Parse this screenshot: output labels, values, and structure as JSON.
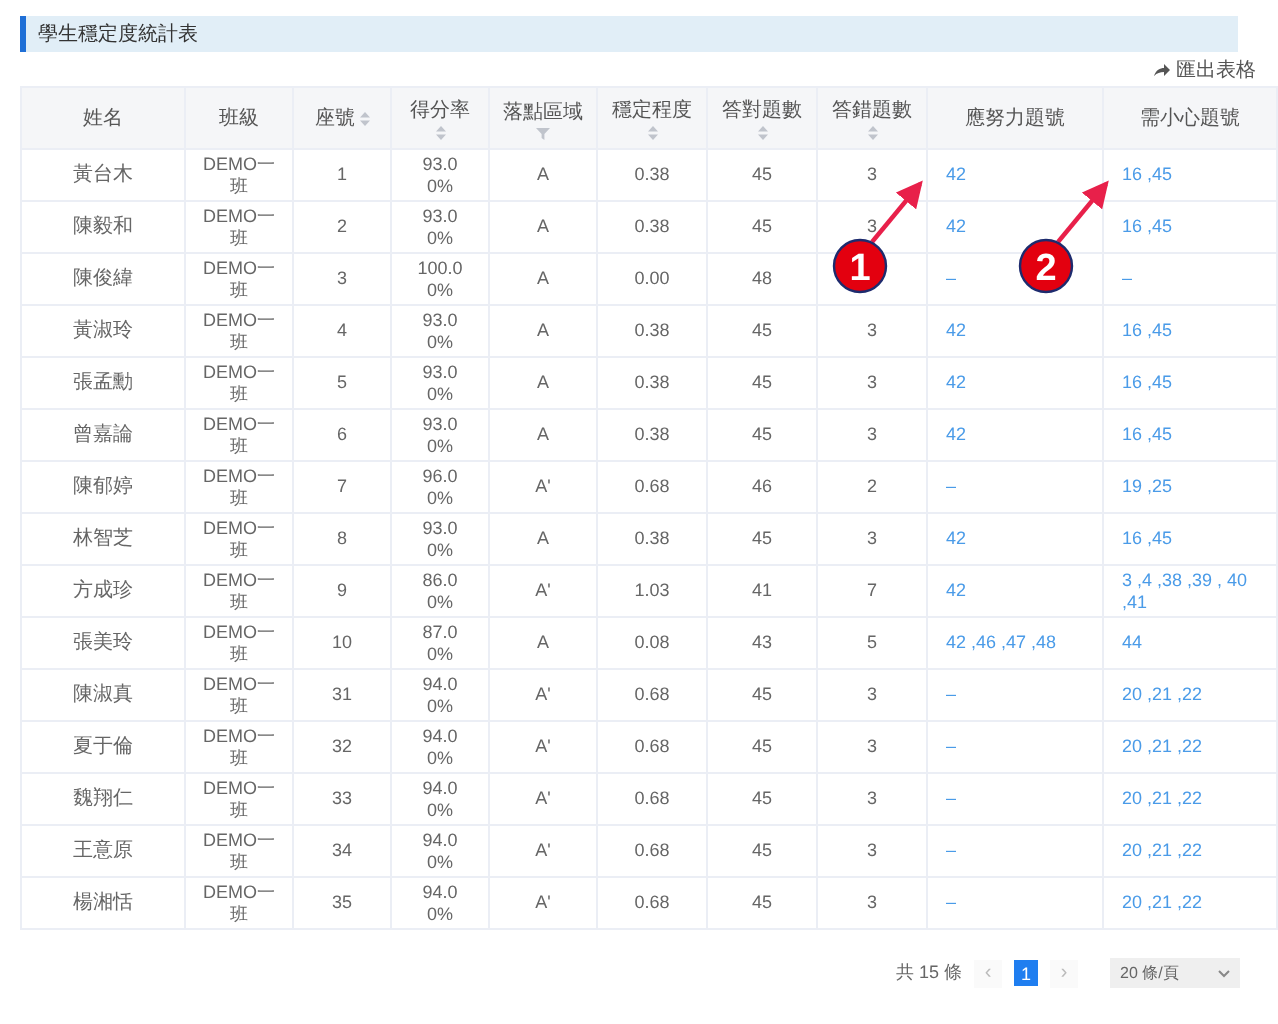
{
  "title": "學生穩定度統計表",
  "export_link": "匯出表格",
  "table": {
    "columns": [
      {
        "label": "姓名",
        "sort": false,
        "filter": false
      },
      {
        "label": "班級",
        "sort": false,
        "filter": false
      },
      {
        "label": "座號",
        "sort": true,
        "filter": false
      },
      {
        "label": "得分率",
        "sort": true,
        "filter": false
      },
      {
        "label": "落點區域",
        "sort": false,
        "filter": true
      },
      {
        "label": "穩定程度",
        "sort": true,
        "filter": false
      },
      {
        "label": "答對題數",
        "sort": true,
        "filter": false
      },
      {
        "label": "答錯題數",
        "sort": true,
        "filter": false
      },
      {
        "label": "應努力題號",
        "sort": false,
        "filter": false
      },
      {
        "label": "需小心題號",
        "sort": false,
        "filter": false
      }
    ],
    "rows": [
      {
        "name": "黃台木",
        "class": "DEMO一班",
        "seat": "1",
        "score": "93.00%",
        "zone": "A",
        "stability": "0.38",
        "correct": "45",
        "wrong": "3",
        "effort": "42",
        "careful": "16 ,45"
      },
      {
        "name": "陳毅和",
        "class": "DEMO一班",
        "seat": "2",
        "score": "93.00%",
        "zone": "A",
        "stability": "0.38",
        "correct": "45",
        "wrong": "3",
        "effort": "42",
        "careful": "16 ,45"
      },
      {
        "name": "陳俊緯",
        "class": "DEMO一班",
        "seat": "3",
        "score": "100.00%",
        "zone": "A",
        "stability": "0.00",
        "correct": "48",
        "effort": "–",
        "careful": "–"
      },
      {
        "name": "黃淑玲",
        "class": "DEMO一班",
        "seat": "4",
        "score": "93.00%",
        "zone": "A",
        "stability": "0.38",
        "correct": "45",
        "wrong": "3",
        "effort": "42",
        "careful": "16 ,45"
      },
      {
        "name": "張孟勳",
        "class": "DEMO一班",
        "seat": "5",
        "score": "93.00%",
        "zone": "A",
        "stability": "0.38",
        "correct": "45",
        "wrong": "3",
        "effort": "42",
        "careful": "16 ,45"
      },
      {
        "name": "曾嘉論",
        "class": "DEMO一班",
        "seat": "6",
        "score": "93.00%",
        "zone": "A",
        "stability": "0.38",
        "correct": "45",
        "wrong": "3",
        "effort": "42",
        "careful": "16 ,45"
      },
      {
        "name": "陳郁婷",
        "class": "DEMO一班",
        "seat": "7",
        "score": "96.00%",
        "zone": "A'",
        "stability": "0.68",
        "correct": "46",
        "wrong": "2",
        "effort": "–",
        "careful": "19 ,25"
      },
      {
        "name": "林智芝",
        "class": "DEMO一班",
        "seat": "8",
        "score": "93.00%",
        "zone": "A",
        "stability": "0.38",
        "correct": "45",
        "wrong": "3",
        "effort": "42",
        "careful": "16 ,45"
      },
      {
        "name": "方成珍",
        "class": "DEMO一班",
        "seat": "9",
        "score": "86.00%",
        "zone": "A'",
        "stability": "1.03",
        "correct": "41",
        "wrong": "7",
        "effort": "42",
        "careful": "3 ,4 ,38 ,39 , 40 ,41"
      },
      {
        "name": "張美玲",
        "class": "DEMO一班",
        "seat": "10",
        "score": "87.00%",
        "zone": "A",
        "stability": "0.08",
        "correct": "43",
        "wrong": "5",
        "effort": "42 ,46 ,47 ,48",
        "careful": "44"
      },
      {
        "name": "陳淑真",
        "class": "DEMO一班",
        "seat": "31",
        "score": "94.00%",
        "zone": "A'",
        "stability": "0.68",
        "correct": "45",
        "wrong": "3",
        "effort": "–",
        "careful": "20 ,21 ,22"
      },
      {
        "name": "夏于倫",
        "class": "DEMO一班",
        "seat": "32",
        "score": "94.00%",
        "zone": "A'",
        "stability": "0.68",
        "correct": "45",
        "wrong": "3",
        "effort": "–",
        "careful": "20 ,21 ,22"
      },
      {
        "name": "魏翔仁",
        "class": "DEMO一班",
        "seat": "33",
        "score": "94.00%",
        "zone": "A'",
        "stability": "0.68",
        "correct": "45",
        "wrong": "3",
        "effort": "–",
        "careful": "20 ,21 ,22"
      },
      {
        "name": "王意原",
        "class": "DEMO一班",
        "seat": "34",
        "score": "94.00%",
        "zone": "A'",
        "stability": "0.68",
        "correct": "45",
        "wrong": "3",
        "effort": "–",
        "careful": "20 ,21 ,22"
      },
      {
        "name": "楊湘恬",
        "class": "DEMO一班",
        "seat": "35",
        "score": "94.00%",
        "zone": "A'",
        "stability": "0.68",
        "correct": "45",
        "wrong": "3",
        "effort": "–",
        "careful": "20 ,21 ,22"
      }
    ]
  },
  "pagination": {
    "total": "共 15 條",
    "prev": "‹",
    "pages": [
      {
        "label": "1",
        "selected": true
      }
    ],
    "next": "›",
    "page_size": "20 條/頁"
  },
  "callouts": [
    {
      "number": "1"
    },
    {
      "number": "2"
    }
  ]
}
